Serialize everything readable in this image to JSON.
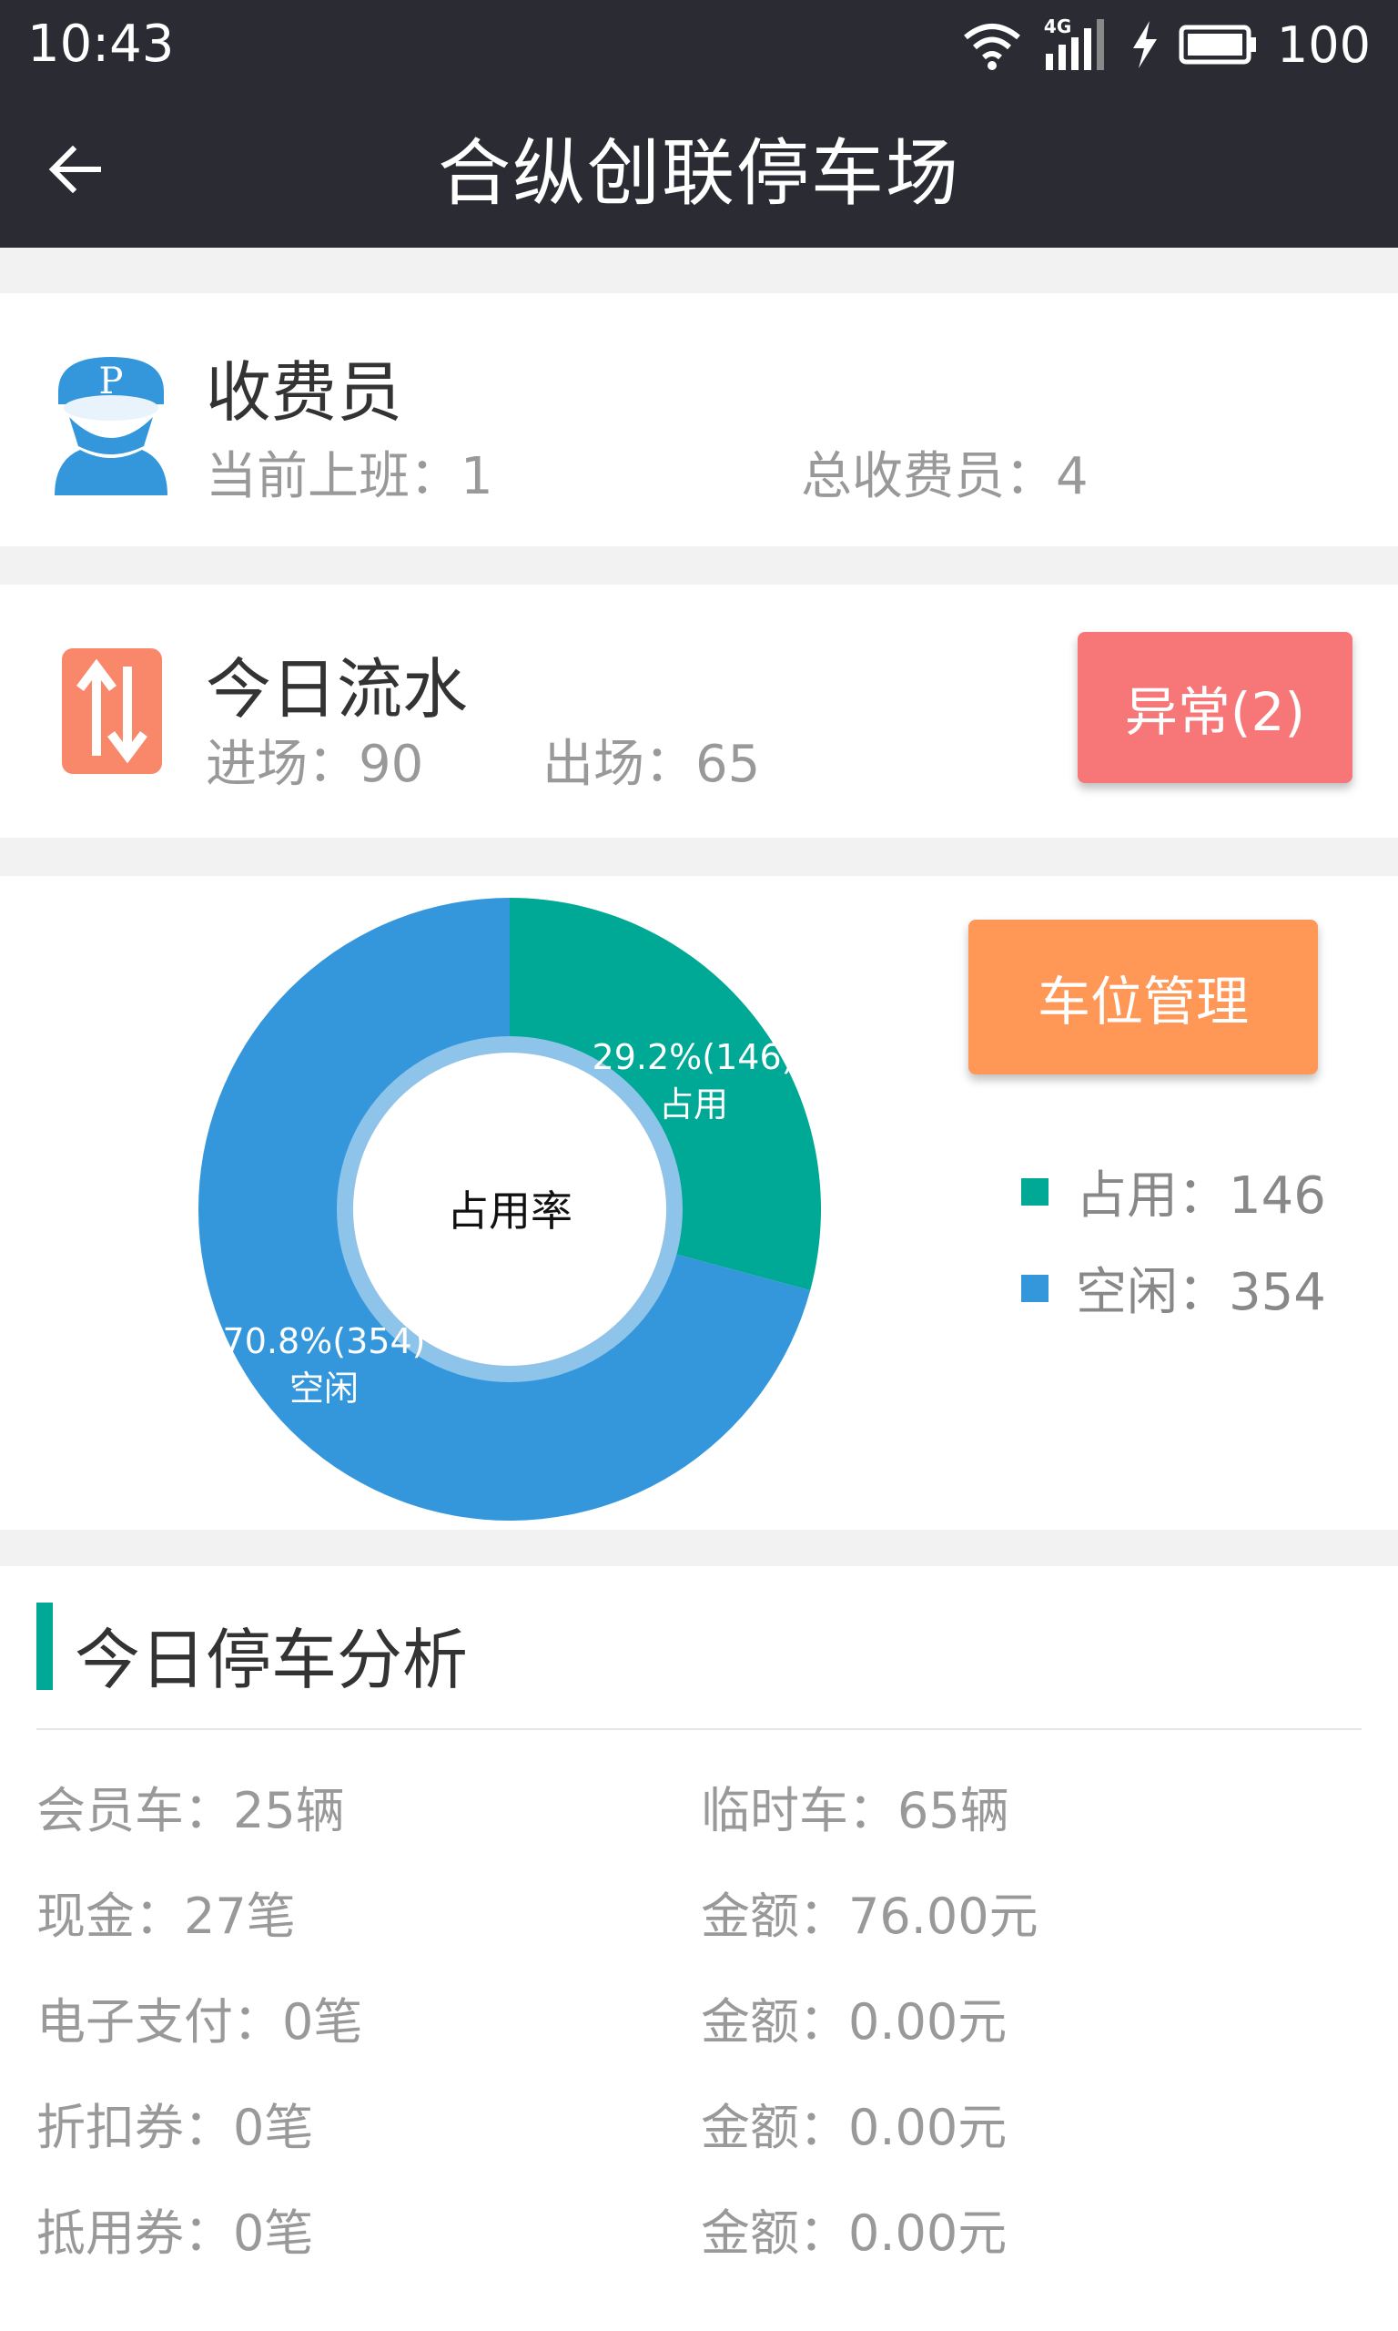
{
  "status_bar": {
    "time": "10:43",
    "network": "4G",
    "battery": "100"
  },
  "app_bar": {
    "title": "合纵创联停车场"
  },
  "collector": {
    "title": "收费员",
    "icon_letter": "P",
    "on_duty": "当前上班：1",
    "total": "总收费员：4"
  },
  "flow": {
    "title": "今日流水",
    "entry": "进场：90",
    "exit": "出场：65",
    "abnormal_label": "异常(2)"
  },
  "occupancy": {
    "center_label": "占用率",
    "parking_manage_label": "车位管理",
    "slices": [
      {
        "label_value": "29.2%(146)",
        "label_name": "占用",
        "value": 146,
        "color": "#00a896"
      },
      {
        "label_value": "70.8%(354)",
        "label_name": "空闲",
        "value": 354,
        "color": "#3597db"
      }
    ],
    "legend": [
      {
        "text": "占用：146",
        "color": "#00a896"
      },
      {
        "text": "空闲：354",
        "color": "#3597db"
      }
    ]
  },
  "analysis": {
    "title": "今日停车分析",
    "rows": [
      {
        "left": "会员车：25辆",
        "right": "临时车：65辆"
      },
      {
        "left": "现金：27笔",
        "right": "金额：76.00元"
      },
      {
        "left": "电子支付：0笔",
        "right": "金额：0.00元"
      },
      {
        "left": "折扣券：0笔",
        "right": "金额：0.00元"
      },
      {
        "left": "抵用券：0笔",
        "right": "金额：0.00元"
      }
    ]
  }
}
